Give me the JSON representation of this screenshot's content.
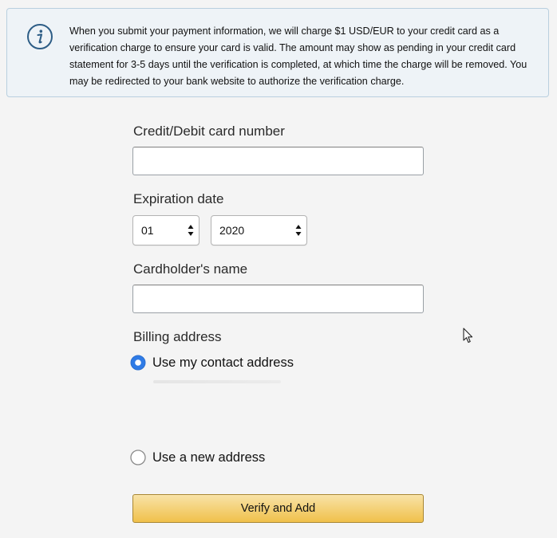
{
  "info": {
    "icon": "info-icon",
    "message": "When you submit your payment information, we will charge $1 USD/EUR to your credit card as a verification charge to ensure your card is valid. The amount may show as pending in your credit card statement for 3-5 days until the verification is completed, at which time the charge will be removed. You may be redirected to your bank website to authorize the verification charge."
  },
  "form": {
    "card_number_label": "Credit/Debit card number",
    "card_number_value": "",
    "expiration_label": "Expiration date",
    "expiration_month": "01",
    "expiration_year": "2020",
    "cardholder_label": "Cardholder's name",
    "cardholder_value": "",
    "billing_label": "Billing address",
    "billing_options": [
      {
        "label": "Use my contact address",
        "selected": true
      },
      {
        "label": "Use a new address",
        "selected": false
      }
    ],
    "submit_label": "Verify and Add"
  },
  "colors": {
    "accent_radio": "#2f7be6",
    "button_top": "#f8e3a7",
    "button_bottom": "#f0c14b",
    "info_border": "#b9cfdf",
    "info_bg": "#eef3f7"
  }
}
